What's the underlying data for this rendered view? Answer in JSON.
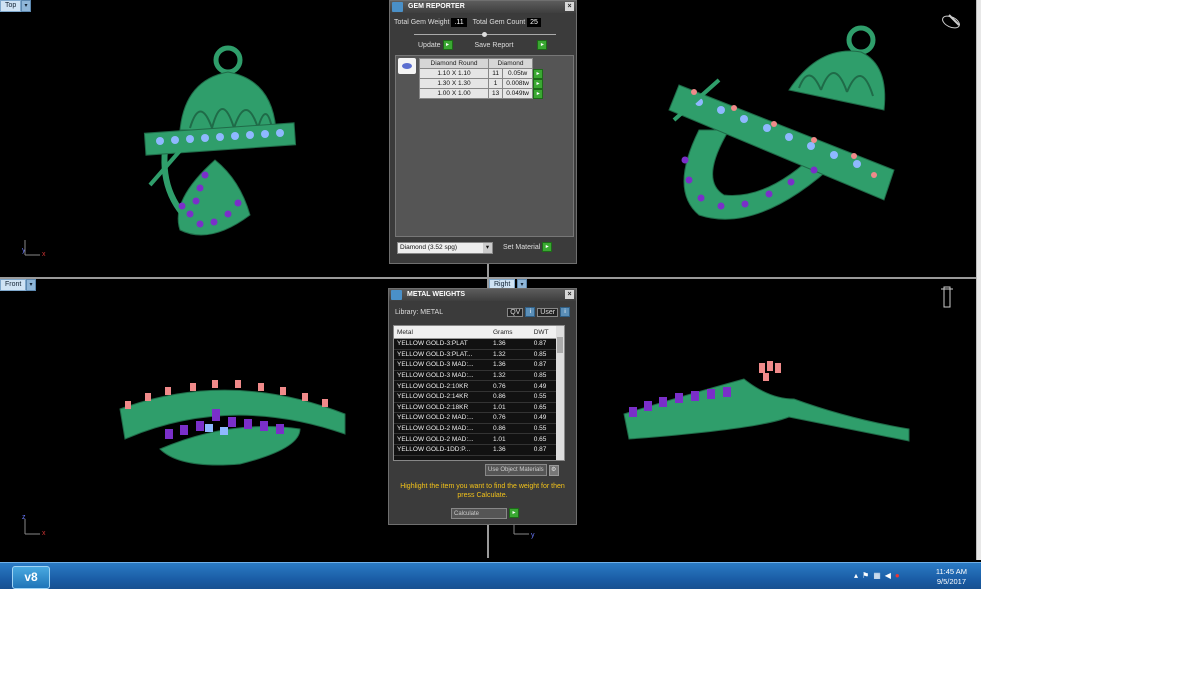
{
  "viewports": {
    "top_label": "Top",
    "front_label": "Front",
    "right_label": "Right"
  },
  "gem_reporter": {
    "title": "GEM REPORTER",
    "total_gem_weight_label": "Total Gem Weight",
    "total_gem_weight_value": ".11",
    "total_gem_count_label": "Total Gem Count",
    "total_gem_count_value": "25",
    "update_label": "Update",
    "save_report_label": "Save Report",
    "table_headers": [
      "Diamond Round",
      "Diamond"
    ],
    "rows": [
      {
        "size": "1.10 X 1.10",
        "count": "11",
        "weight": "0.05tw"
      },
      {
        "size": "1.30 X 1.30",
        "count": "1",
        "weight": "0.008tw"
      },
      {
        "size": "1.00 X 1.00",
        "count": "13",
        "weight": "0.049tw"
      }
    ],
    "material_select": "Diamond    (3.52 spg)",
    "set_material_label": "Set Material"
  },
  "metal_weights": {
    "title": "METAL WEIGHTS",
    "library_label": "Library: METAL",
    "qv_label": "QV",
    "user_label": "User",
    "columns": [
      "Metal",
      "Grams",
      "DWT"
    ],
    "rows": [
      {
        "metal": "YELLOW GOLD-3:PLAT",
        "grams": "1.36",
        "dwt": "0.87"
      },
      {
        "metal": "YELLOW GOLD-3:PLAT...",
        "grams": "1.32",
        "dwt": "0.85"
      },
      {
        "metal": "YELLOW GOLD-3 MAD:...",
        "grams": "1.36",
        "dwt": "0.87"
      },
      {
        "metal": "YELLOW GOLD-3 MAD:...",
        "grams": "1.32",
        "dwt": "0.85"
      },
      {
        "metal": "YELLOW GOLD-2:10KR",
        "grams": "0.76",
        "dwt": "0.49"
      },
      {
        "metal": "YELLOW GOLD-2:14KR",
        "grams": "0.86",
        "dwt": "0.55"
      },
      {
        "metal": "YELLOW GOLD-2:18KR",
        "grams": "1.01",
        "dwt": "0.65"
      },
      {
        "metal": "YELLOW GOLD-2 MAD:...",
        "grams": "0.76",
        "dwt": "0.49"
      },
      {
        "metal": "YELLOW GOLD-2 MAD:...",
        "grams": "0.86",
        "dwt": "0.55"
      },
      {
        "metal": "YELLOW GOLD-2 MAD:...",
        "grams": "1.01",
        "dwt": "0.65"
      },
      {
        "metal": "YELLOW GOLD-1DD:P...",
        "grams": "1.36",
        "dwt": "0.87"
      }
    ],
    "use_object_label": "Use Object Materials",
    "instruction": "Highlight the item you want to find the weight for then press Calculate.",
    "calculate_label": "Calculate"
  },
  "taskbar": {
    "start_label": "v8",
    "time": "11:45 AM",
    "date": "9/5/2017"
  },
  "colors": {
    "metal_green": "#2f9e6b",
    "gem_blue": "#8fb8ff",
    "gem_purple": "#7a2fc9",
    "gem_pink": "#f08a8a",
    "instruction_yellow": "#f2c21a"
  }
}
